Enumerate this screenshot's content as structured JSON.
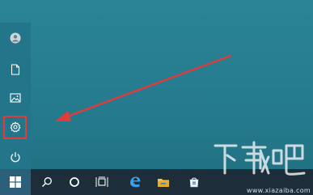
{
  "start_menu": {
    "items": [
      {
        "icon": "user-avatar-icon"
      },
      {
        "icon": "document-icon"
      },
      {
        "icon": "pictures-icon"
      },
      {
        "icon": "settings-gear-icon"
      },
      {
        "icon": "power-icon"
      }
    ],
    "highlight_color": "#e23b3b"
  },
  "annotation": {
    "arrow_color": "#e23b3b"
  },
  "taskbar": {
    "items": [
      {
        "icon": "windows-start-icon"
      },
      {
        "icon": "search-icon"
      },
      {
        "icon": "cortana-icon"
      },
      {
        "icon": "task-view-icon"
      },
      {
        "icon": "edge-browser-icon"
      },
      {
        "icon": "file-explorer-icon"
      },
      {
        "icon": "store-icon"
      }
    ]
  },
  "watermark": {
    "logo_text": "下载吧",
    "url": "www.xiazaiba.com"
  },
  "colors": {
    "desktop": "#257b8d",
    "taskbar": "#1d2e3a",
    "start_rail": "#237689",
    "accent": "#e23b3b"
  }
}
